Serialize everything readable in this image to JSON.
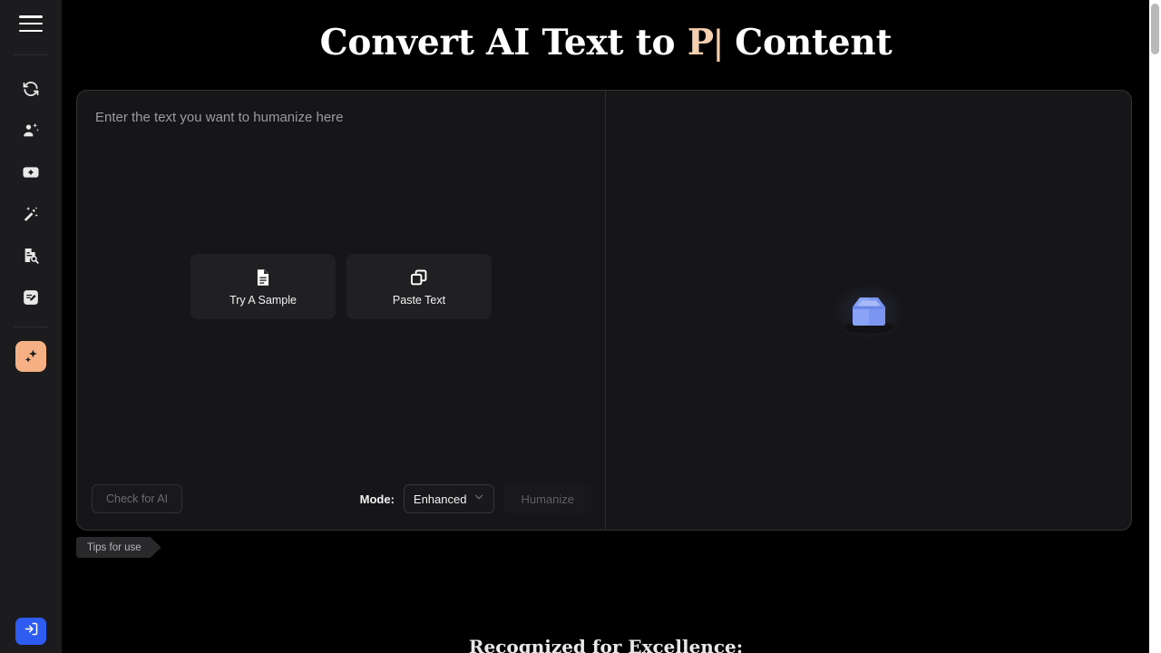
{
  "page": {
    "background_color": "#000000",
    "title_prefix": "Convert AI Text to ",
    "title_accent": "P",
    "title_caret": "|",
    "title_suffix": " Content",
    "recognition_heading": "Recognized for Excellence:"
  },
  "sidebar": {
    "background_color": "#1c1c1e",
    "menu_icon": "hamburger-menu-icon",
    "items": [
      {
        "id": "paraphraser",
        "icon": "refresh-cycle-icon",
        "active": false
      },
      {
        "id": "humanizer-tool",
        "icon": "person-sparkle-icon",
        "active": false
      },
      {
        "id": "ai-content-add",
        "icon": "plus-square-icon",
        "active": false
      },
      {
        "id": "magic-wand",
        "icon": "magic-wand-sparkle-icon",
        "active": false
      },
      {
        "id": "ai-detector",
        "icon": "document-search-icon",
        "active": false
      },
      {
        "id": "ai-writer",
        "icon": "document-edit-icon",
        "active": false
      }
    ],
    "active_item": {
      "id": "humanizer",
      "icon": "sparkles-icon",
      "color": "#f5b183"
    },
    "login": {
      "icon": "login-arrow-icon",
      "color": "#2f5cf0"
    }
  },
  "workspace": {
    "input": {
      "placeholder": "Enter the text you want to humanize here",
      "value": "",
      "quick_actions": [
        {
          "id": "try-a-sample",
          "label": "Try A Sample",
          "icon": "document-lines-icon"
        },
        {
          "id": "paste-text",
          "label": "Paste Text",
          "icon": "copy-stack-icon"
        }
      ]
    },
    "output": {
      "value": "",
      "empty_illustration": "empty-box-icon"
    },
    "toolbar": {
      "check_ai_label": "Check for AI",
      "check_ai_disabled": true,
      "mode_label": "Mode:",
      "mode_value": "Enhanced",
      "mode_options": [
        "Enhanced"
      ],
      "humanize_label": "Humanize",
      "humanize_disabled": true
    }
  },
  "tips": {
    "label": "Tips for use"
  },
  "scrollbar": {
    "thumb_color": "#b9b9b9"
  }
}
